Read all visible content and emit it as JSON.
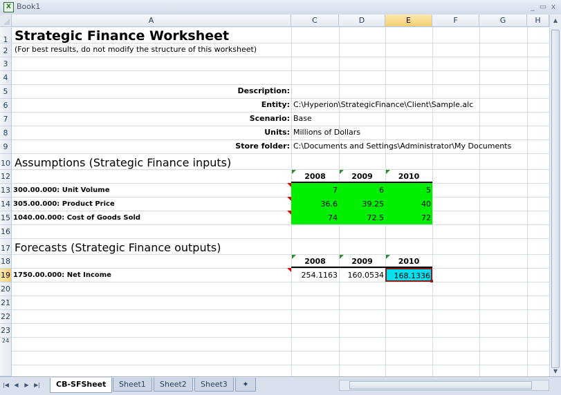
{
  "window": {
    "title": "Book1",
    "minimize_glyph": "_",
    "maximize_glyph": "▭",
    "close_glyph": "x"
  },
  "columns": [
    "A",
    "C",
    "D",
    "E",
    "F",
    "G",
    "H"
  ],
  "rows": [
    "1",
    "2",
    "3",
    "4",
    "5",
    "6",
    "7",
    "8",
    "9",
    "10",
    "12",
    "13",
    "14",
    "15",
    "16",
    "17",
    "18",
    "19",
    "20",
    "21",
    "22",
    "23",
    "24"
  ],
  "selected_column": "E",
  "selected_row": "19",
  "sheet": {
    "title": "Strategic Finance Worksheet",
    "note": "(For best results, do not modify the structure of this worksheet)",
    "labels": {
      "description": "Description:",
      "entity": "Entity:",
      "scenario": "Scenario:",
      "units": "Units:",
      "store_folder": "Store folder:"
    },
    "values": {
      "entity": "C:\\Hyperion\\StrategicFinance\\Client\\Sample.alc",
      "scenario": "Base",
      "units": "Millions of Dollars",
      "store_folder": "C:\\Documents and Settings\\Administrator\\My Documents"
    },
    "assumptions": {
      "heading": "Assumptions (Strategic Finance inputs)",
      "years": [
        "2008",
        "2009",
        "2010"
      ],
      "rows": [
        {
          "label": "300.00.000: Unit Volume",
          "values": [
            "7",
            "6",
            "5"
          ]
        },
        {
          "label": "305.00.000: Product Price",
          "values": [
            "36.6",
            "39.25",
            "40"
          ]
        },
        {
          "label": "1040.00.000: Cost of Goods Sold",
          "values": [
            "74",
            "72.5",
            "72"
          ]
        }
      ]
    },
    "forecasts": {
      "heading": "Forecasts (Strategic Finance outputs)",
      "years": [
        "2008",
        "2009",
        "2010"
      ],
      "rows": [
        {
          "label": "1750.00.000: Net Income",
          "values": [
            "254.1163",
            "160.0534",
            "168.1336"
          ]
        }
      ]
    }
  },
  "tabs": [
    "CB-SFSheet",
    "Sheet1",
    "Sheet2",
    "Sheet3"
  ],
  "active_tab": "CB-SFSheet",
  "colors": {
    "input_fill": "#00ee00",
    "selected_cell_fill": "#00e0ee",
    "selected_border": "#8b1a1a",
    "comment_marker": "#e00000",
    "error_marker": "#2e8b2e"
  }
}
